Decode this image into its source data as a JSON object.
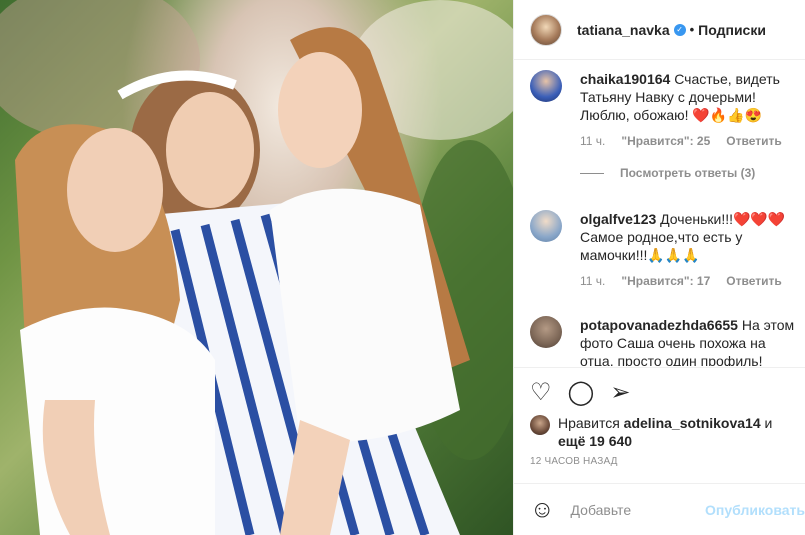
{
  "header": {
    "username": "tatiana_navka",
    "verified_icon": "verified-badge-icon",
    "separator": "•",
    "follow_label": "Подписки"
  },
  "comments": [
    {
      "username": "chaika190164",
      "text": "Счастье, видеть Татьяну Навку с дочерьми! Люблю, обожаю! ❤️🔥👍😍",
      "time": "11 ч.",
      "likes": "\"Нравится\": 25",
      "reply": "Ответить",
      "view_replies": "Посмотреть ответы (3)"
    },
    {
      "username": "olgalfve123",
      "text": "Доченьки!!!❤️❤️❤️ Самое родное,что есть у мамочки!!!🙏🙏🙏",
      "time": "11 ч.",
      "likes": "\"Нравится\": 17",
      "reply": "Ответить"
    },
    {
      "username": "potapovanadezhda6655",
      "text": "На этом фото Саша очень похожа на отца, просто один профиль!"
    }
  ],
  "actions": {
    "like_icon": "heart-icon",
    "comment_icon": "comment-icon",
    "share_icon": "share-icon"
  },
  "likes": {
    "prefix": "Нравится",
    "user": "adelina_sotnikova14",
    "and": "и",
    "others": "ещё 19 640"
  },
  "timestamp": "12 ЧАСОВ НАЗАД",
  "add_comment": {
    "emoji_icon": "smiley-icon",
    "placeholder": "Добавьте",
    "publish_label": "Опубликовать"
  }
}
